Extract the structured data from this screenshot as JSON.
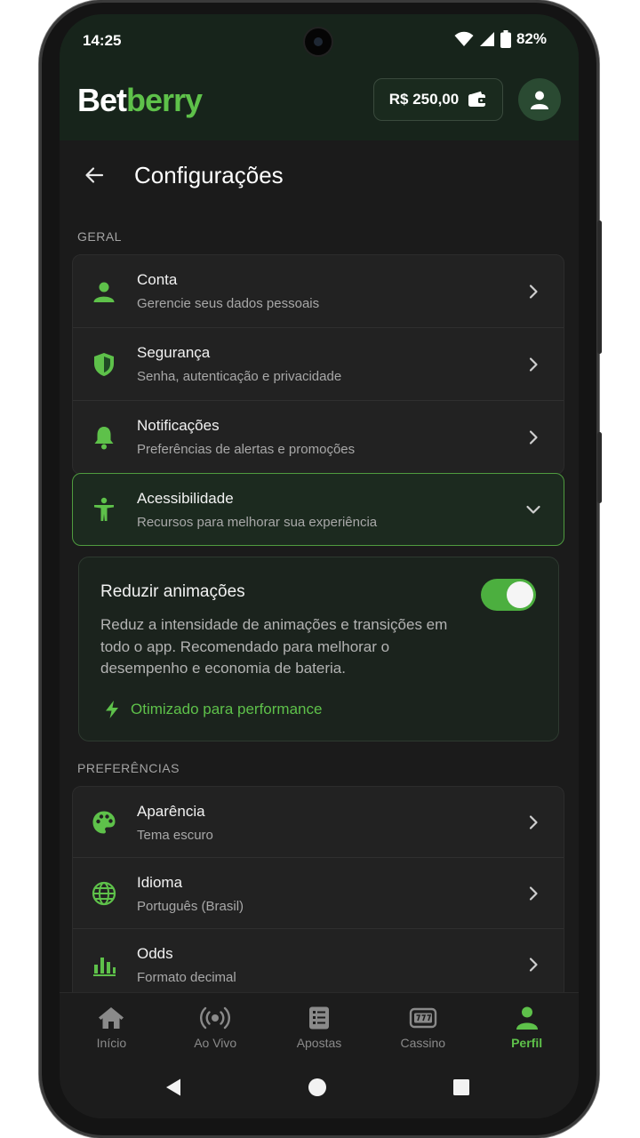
{
  "status": {
    "time": "14:25",
    "battery": "82%"
  },
  "header": {
    "brand_a": "Bet",
    "brand_b": "berry",
    "balance": "R$ 250,00"
  },
  "page": {
    "title": "Configurações"
  },
  "sections": {
    "general": "GERAL",
    "preferences": "PREFERÊNCIAS"
  },
  "general_items": [
    {
      "title": "Conta",
      "subtitle": "Gerencie seus dados pessoais",
      "icon": "user-icon"
    },
    {
      "title": "Segurança",
      "subtitle": "Senha, autenticação e privacidade",
      "icon": "shield-icon"
    },
    {
      "title": "Notificações",
      "subtitle": "Preferências de alertas e promoções",
      "icon": "bell-icon"
    },
    {
      "title": "Acessibilidade",
      "subtitle": "Recursos para melhorar sua experiência",
      "icon": "accessibility-icon"
    }
  ],
  "reduce_animations": {
    "title": "Reduzir animações",
    "description": "Reduz a intensidade de animações e transições em todo o app. Recomendado para melhorar o desempenho e economia de bateria.",
    "hint": "Otimizado para performance",
    "enabled": true
  },
  "preference_items": [
    {
      "title": "Aparência",
      "subtitle": "Tema escuro",
      "icon": "palette-icon"
    },
    {
      "title": "Idioma",
      "subtitle": "Português (Brasil)",
      "icon": "globe-icon"
    },
    {
      "title": "Odds",
      "subtitle": "Formato decimal",
      "icon": "chart-icon"
    }
  ],
  "nav": [
    {
      "label": "Início",
      "icon": "home-icon"
    },
    {
      "label": "Ao Vivo",
      "icon": "live-icon"
    },
    {
      "label": "Apostas",
      "icon": "betslip-icon"
    },
    {
      "label": "Cassino",
      "icon": "slot-icon"
    },
    {
      "label": "Perfil",
      "icon": "profile-icon",
      "active": true
    }
  ],
  "colors": {
    "accent": "#5ec14a",
    "background": "#1b1b1b",
    "card": "#222222"
  }
}
